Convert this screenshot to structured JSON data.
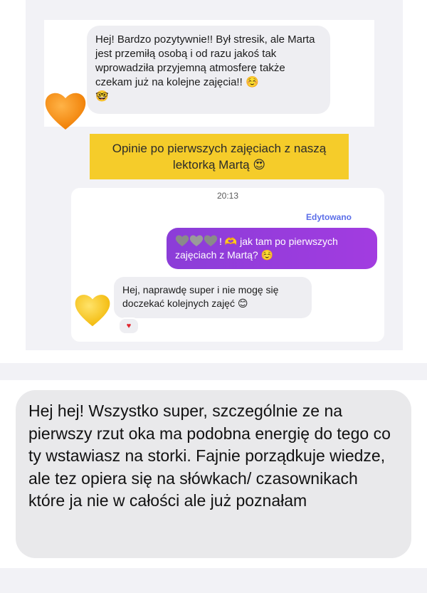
{
  "top_chat": {
    "message": "Hej! Bardzo pozytywnie!! Był stresik, ale Marta jest przemiłą osobą i od razu jakoś tak wprowadziła przyjemną atmosferę także czekam już na kolejne zajęcia!! ☺️",
    "message_emoji": "🤓",
    "avatar_icon": "orange-heart-icon",
    "avatar_color": "#f28a12"
  },
  "banner": {
    "text": "Opinie po pierwszych zajęciach z naszą lektorką Martą 😍",
    "color": "#f5cc2a"
  },
  "second_chat": {
    "time": "20:13",
    "edited_label": "Edytowano",
    "outgoing_message": "🫶 jak tam po pierwszych zajęciach z Martą? ☺️",
    "outgoing_prefix": "!",
    "incoming_message": "Hej, naprawdę super i nie mogę się doczekać kolejnych zajęć 😊",
    "reaction": "♥",
    "avatar_icon": "yellow-heart-icon",
    "avatar_color": "#f5c518",
    "outgoing_color": "#9a3cdf"
  },
  "bottom_chat": {
    "message": "Hej hej! Wszystko super, szczególnie ze na pierwszy rzut oka ma podobna energię do tego co ty wstawiasz na storki. Fajnie porządkuje wiedze, ale tez opiera się na słówkach/ czasownikach które ja nie w całości ale już poznałam"
  }
}
